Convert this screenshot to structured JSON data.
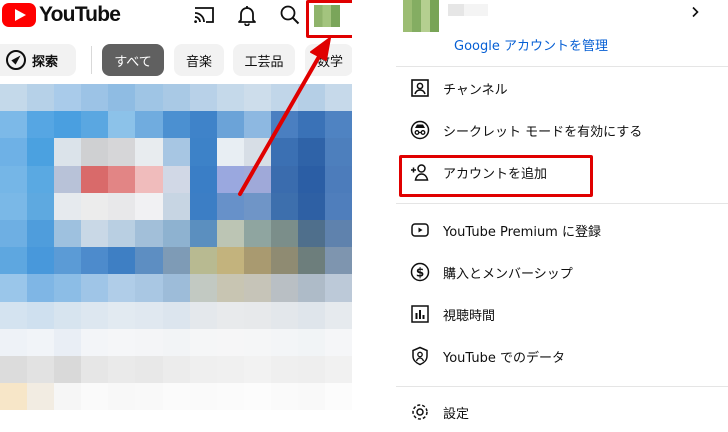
{
  "left": {
    "logo": {
      "text": "YouTube"
    },
    "top_icons": [
      "cast-icon",
      "bell-icon",
      "search-icon"
    ],
    "chips": [
      {
        "label": "探索"
      },
      {
        "label": "すべて"
      },
      {
        "label": "音楽"
      },
      {
        "label": "工芸品"
      },
      {
        "label": "数学"
      }
    ],
    "colors": {
      "youtube_red": "#ff0000",
      "highlight": "#e00000",
      "selected_chip": "#606060"
    }
  },
  "right": {
    "manage_account_label": "Google アカウントを管理",
    "menu": [
      {
        "label": "チャンネル",
        "icon": "channel-icon"
      },
      {
        "label": "シークレット モードを有効にする",
        "icon": "incognito-icon"
      },
      {
        "label": "アカウントを追加",
        "icon": "add-account-icon"
      },
      {
        "label": "YouTube Premium に登録",
        "icon": "youtube-premium-icon"
      },
      {
        "label": "購入とメンバーシップ",
        "icon": "dollar-icon"
      },
      {
        "label": "視聴時間",
        "icon": "bar-chart-icon"
      },
      {
        "label": "YouTube でのデータ",
        "icon": "shield-person-icon"
      },
      {
        "label": "設定",
        "icon": "gear-icon"
      }
    ],
    "colors": {
      "link": "#065fd4"
    }
  }
}
